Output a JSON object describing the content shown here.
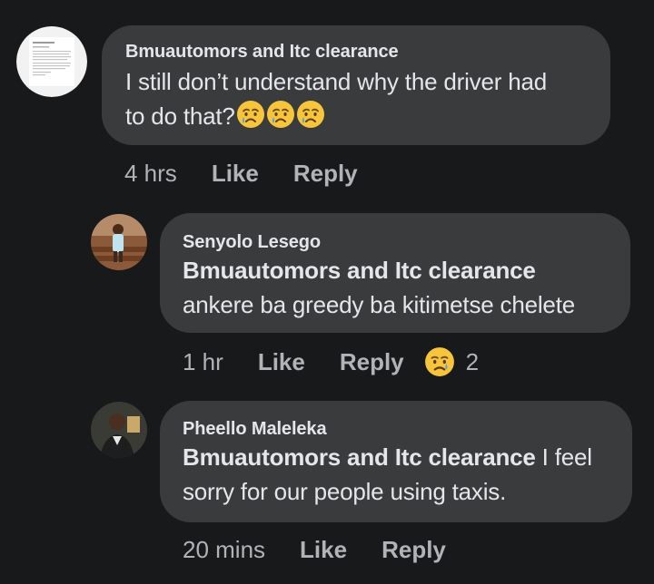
{
  "comments": [
    {
      "author": "Bmuautomors and Itc clearance",
      "text_line1": "I still don’t understand why the driver had",
      "text_line2": "to do that?",
      "emoji": "crying-face-icon",
      "time": "4 hrs",
      "like_label": "Like",
      "reply_label": "Reply"
    },
    {
      "author": "Senyolo Lesego",
      "mention": "Bmuautomors and Itc clearance",
      "text": "ankere ba greedy ba kitimetse chelete",
      "time": "1 hr",
      "like_label": "Like",
      "reply_label": "Reply",
      "reaction": "sad-face-icon",
      "reaction_count": "2"
    },
    {
      "author": "Pheello Maleleka",
      "mention": "Bmuautomors and Itc clearance",
      "text_line1_rest": " I feel",
      "text_line2": "sorry for our people using taxis.",
      "time": "20 mins",
      "like_label": "Like",
      "reply_label": "Reply"
    }
  ],
  "colors": {
    "background": "#18191a",
    "bubble": "#3a3b3c",
    "text": "#e4e6eb",
    "secondary": "#b0b3b8"
  }
}
